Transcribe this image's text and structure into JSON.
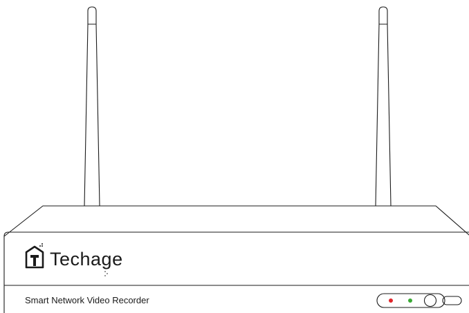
{
  "device": {
    "brand": "Techage",
    "model_label": "Smart Network Video Recorder"
  },
  "indicators": {
    "led_left_color": "#e0262b",
    "led_right_color": "#3aa935"
  },
  "icons": {
    "logo": "house-t-logo-icon",
    "power_button": "power-button-icon",
    "usb_port": "usb-port-icon",
    "antenna": "antenna-icon"
  },
  "colors": {
    "line": "#1a1a1a",
    "background": "#ffffff"
  }
}
